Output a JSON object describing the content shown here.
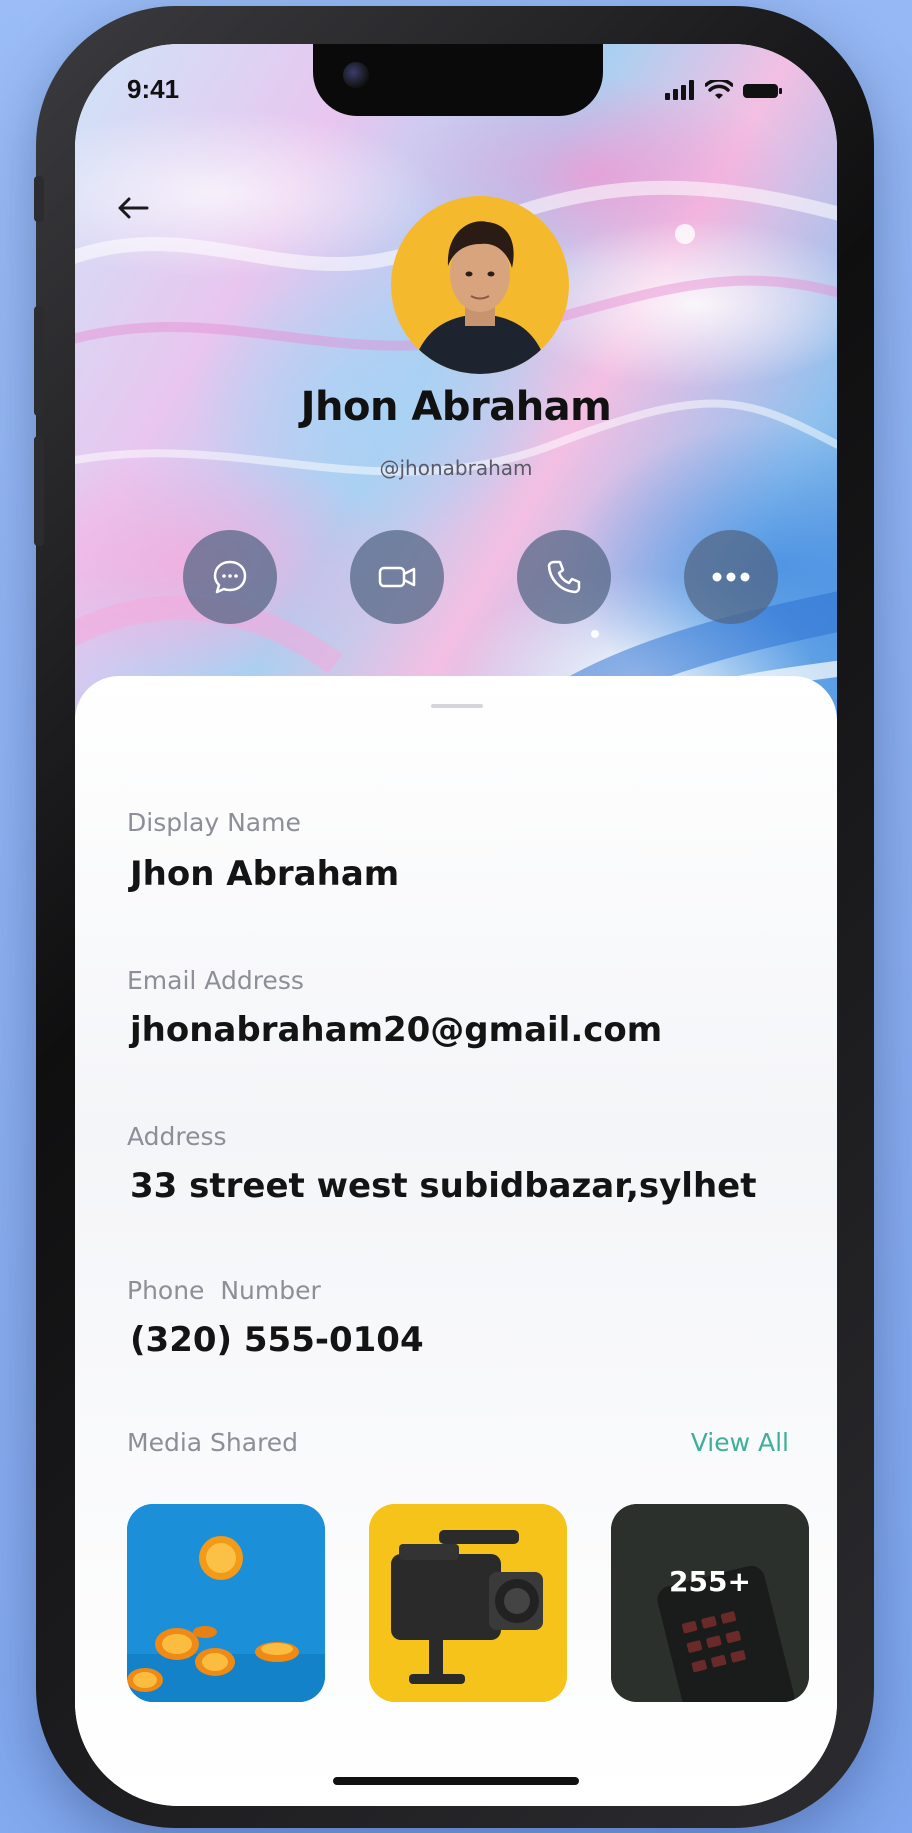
{
  "status_bar": {
    "time": "9:41"
  },
  "header": {
    "back_icon": "arrow-left-icon"
  },
  "profile": {
    "name": "Jhon Abraham",
    "handle": "@jhonabraham"
  },
  "actions": [
    {
      "name": "message",
      "icon": "chat-bubble-icon"
    },
    {
      "name": "video-call",
      "icon": "video-camera-icon"
    },
    {
      "name": "voice-call",
      "icon": "phone-icon"
    },
    {
      "name": "more",
      "icon": "more-dots-icon"
    }
  ],
  "details": {
    "display_name_label": "Display Name",
    "display_name": "Jhon Abraham",
    "email_label": "Email Address",
    "email": "jhonabraham20@gmail.com",
    "address_label": "Address",
    "address": "33 street west subidbazar,sylhet",
    "phone_label": "Phone  Number",
    "phone": "(320) 555-0104"
  },
  "media": {
    "label": "Media Shared",
    "view_all": "View All",
    "items": [
      {
        "kind": "image",
        "subject": "oranges"
      },
      {
        "kind": "image",
        "subject": "camera"
      },
      {
        "kind": "more",
        "count": "255+"
      }
    ]
  },
  "colors": {
    "accent": "#3fae9a",
    "avatar_bg": "#f5b92e",
    "action_button_bg": "#50648299",
    "page_bg": "#8fb2f0"
  }
}
